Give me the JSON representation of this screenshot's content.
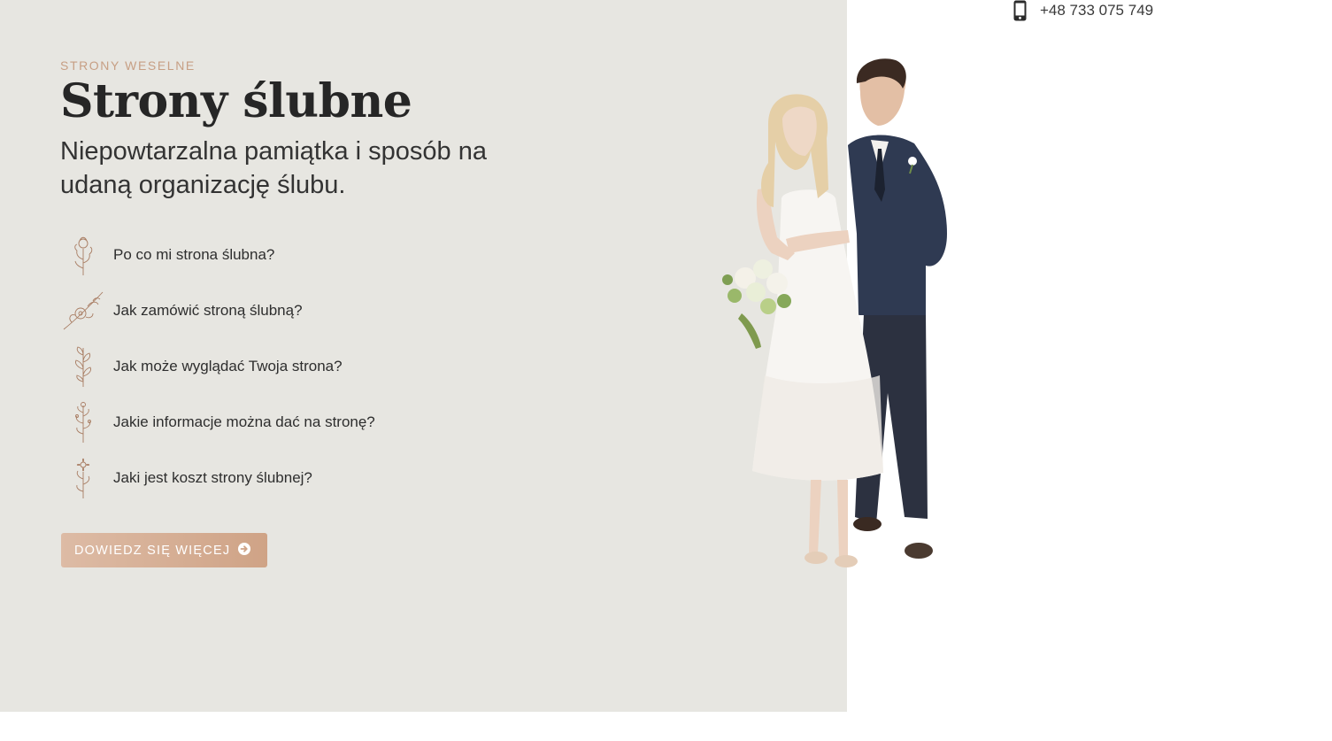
{
  "header": {
    "phone": "+48 733 075 749",
    "phone_icon": "mobile-phone-icon"
  },
  "hero": {
    "eyebrow": "STRONY WESELNE",
    "title": "Strony ślubne",
    "subtitle": "Niepowtarzalna pamiątka i sposób na udaną organizację ślubu.",
    "faq": [
      {
        "label": "Po co mi strona ślubna?",
        "icon": "flower-bouquet-icon"
      },
      {
        "label": "Jak zamówić stroną ślubną?",
        "icon": "flower-branch-icon"
      },
      {
        "label": "Jak może wyglądać Twoja strona?",
        "icon": "leaf-sprig-icon"
      },
      {
        "label": "Jakie informacje można dać na stronę?",
        "icon": "wildflower-icon"
      },
      {
        "label": "Jaki jest koszt strony ślubnej?",
        "icon": "blossom-stem-icon"
      }
    ],
    "cta_label": "DOWIEDZ SIĘ WIĘCEJ",
    "cta_icon": "arrow-circle-right-icon"
  },
  "colors": {
    "panel_bg": "#e7e6e1",
    "accent": "#c79f84",
    "cta_start": "#ddbba5",
    "cta_end": "#cfa386"
  }
}
